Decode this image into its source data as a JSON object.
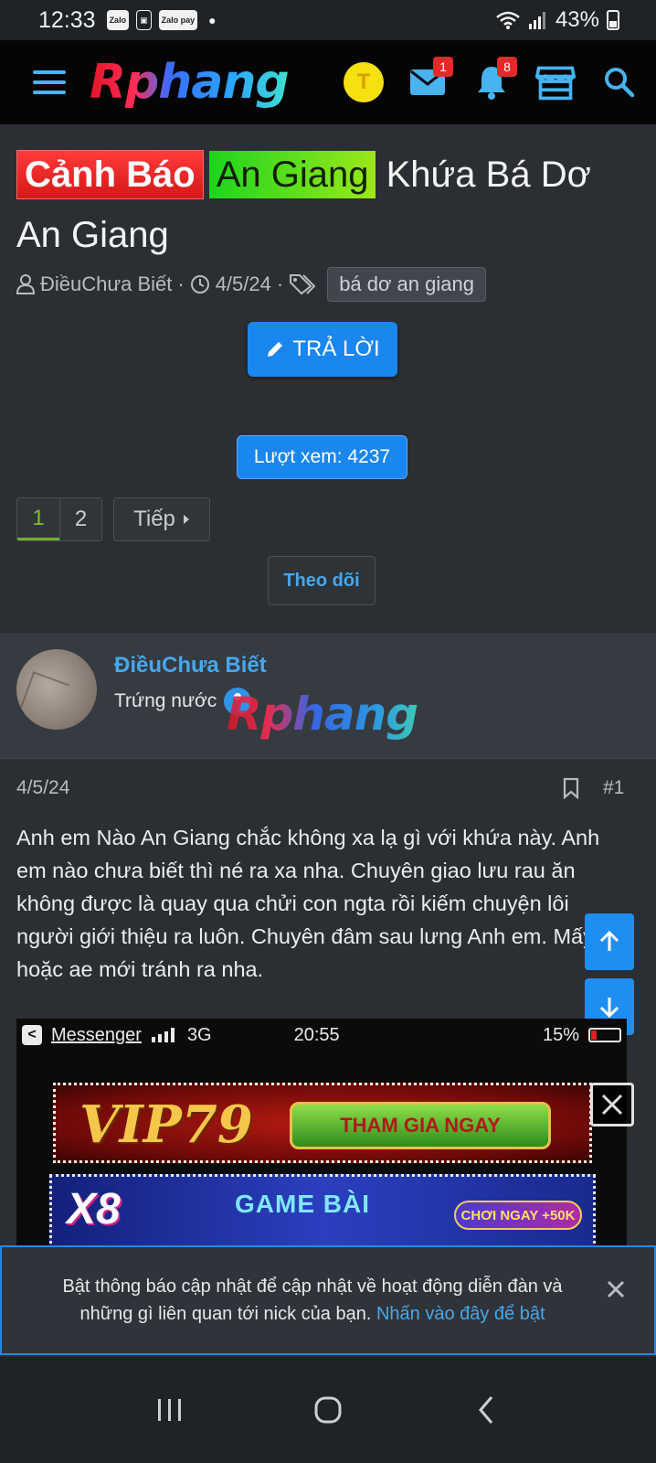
{
  "status_bar": {
    "time": "12:33",
    "apps": [
      "Zalo",
      "Zalo pay"
    ],
    "battery": "43%"
  },
  "header": {
    "logo": "Rphang",
    "user_initial": "T",
    "messages_badge": "1",
    "alerts_badge": "8"
  },
  "thread": {
    "title_prefix_red": "Cảnh Báo",
    "title_prefix_green": "An Giang",
    "title": "Khứa Bá Dơ An Giang",
    "author": "ĐiềuChưa Biết",
    "date": "4/5/24",
    "tag": "bá dơ an giang",
    "reply_label": "TRẢ LỜI",
    "views_label": "Lượt xem: 4237",
    "pages": [
      "1",
      "2"
    ],
    "next_label": "Tiếp",
    "follow_label": "Theo dõi"
  },
  "post": {
    "author": "ĐiềuChưa Biết",
    "rank": "Trứng nước",
    "watermark": "Rphang",
    "date": "4/5/24",
    "number": "#1",
    "body": "Anh em Nào An Giang chắc không xa lạ gì với khứa này. Anh em nào chưa biết thì né ra xa nha. Chuyên giao lưu rau ăn không được là quay qua chửi con ngta rồi kiếm chuyện lôi người giới thiệu ra luôn. Chuyên đâm sau lưng Anh em. Mấy bé hoặc ae mới tránh ra nha."
  },
  "embed": {
    "app": "Messenger",
    "network": "3G",
    "time": "20:55",
    "battery": "15%"
  },
  "ads": {
    "ad1_brand": "VIP79",
    "ad1_cta": "THAM GIA NGAY",
    "ad2_brand": "X8",
    "ad2_title": "GAME BÀI",
    "ad2_bonus": "CHƠI NGAY +50K"
  },
  "notice": {
    "text": "Bật thông báo cập nhật để cập nhật về hoạt động diễn đàn và những gì liên quan tới nick của bạn.",
    "link": "Nhấn vào đây để bật"
  },
  "colors": {
    "accent": "#1a86f0",
    "link": "#47a7ec",
    "page_bg": "#2b2f33"
  }
}
